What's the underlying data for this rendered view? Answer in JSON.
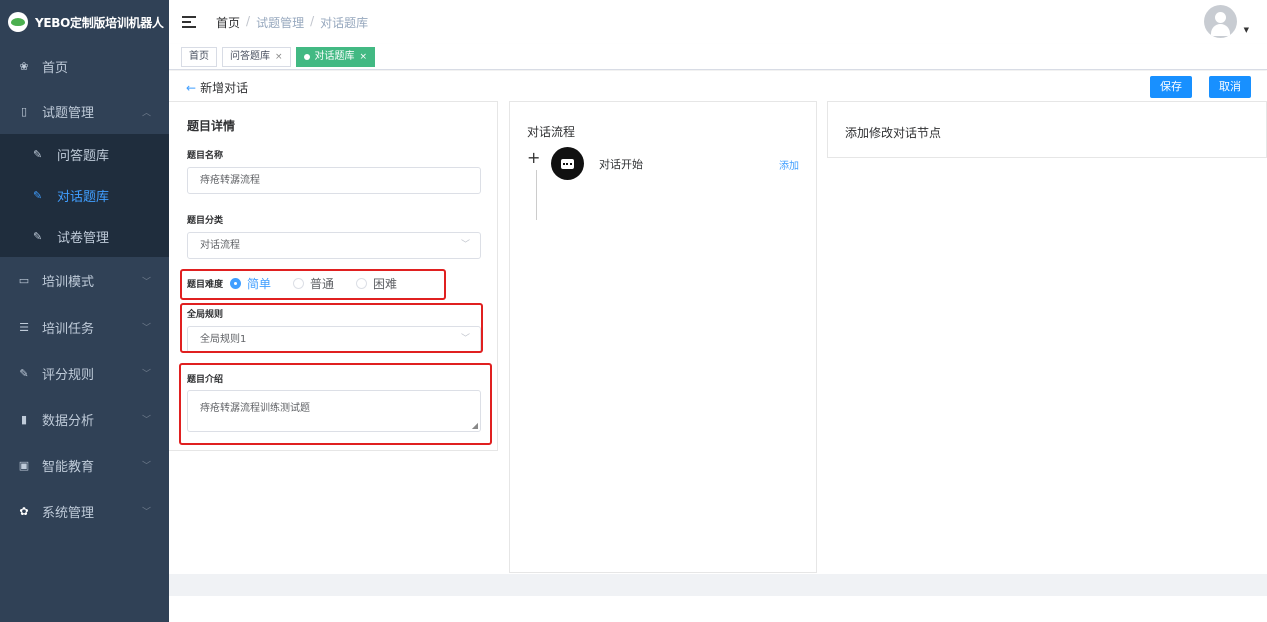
{
  "sidebar": {
    "logo_text": "YEBO定制版培训机器人",
    "items": [
      {
        "label": "首页",
        "icon": "dashboard-icon"
      },
      {
        "label": "试题管理",
        "icon": "book-icon"
      },
      {
        "label": "培训模式",
        "icon": "monitor-icon"
      },
      {
        "label": "培训任务",
        "icon": "list-icon"
      },
      {
        "label": "评分规则",
        "icon": "edit-icon"
      },
      {
        "label": "数据分析",
        "icon": "chart-icon"
      },
      {
        "label": "智能教育",
        "icon": "screen-icon"
      },
      {
        "label": "系统管理",
        "icon": "gear-icon"
      }
    ],
    "sub_items": [
      {
        "label": "问答题库"
      },
      {
        "label": "对话题库"
      },
      {
        "label": "试卷管理"
      }
    ]
  },
  "header": {
    "breadcrumb": [
      "首页",
      "试题管理",
      "对话题库"
    ],
    "separator": "/"
  },
  "tags": [
    {
      "label": "首页"
    },
    {
      "label": "问答题库"
    },
    {
      "label": "对话题库"
    }
  ],
  "page": {
    "back_label": "新增对话",
    "save_label": "保存",
    "cancel_label": "取消"
  },
  "details": {
    "title": "题目详情",
    "name_label": "题目名称",
    "name_value": "痔疮转潺流程",
    "category_label": "题目分类",
    "category_value": "对话流程",
    "difficulty_label": "题目难度",
    "difficulty_options": [
      "简单",
      "普通",
      "困难"
    ],
    "difficulty_selected": "简单",
    "rule_label": "全局规则",
    "rule_value": "全局规则1",
    "intro_label": "题目介绍",
    "intro_value": "痔疮转潺流程训练测试题"
  },
  "flow": {
    "title": "对话流程",
    "node_label": "对话开始",
    "add_label": "添加"
  },
  "node_editor": {
    "title": "添加修改对话节点"
  },
  "colors": {
    "sidebar_bg": "#304156",
    "submenu_bg": "#1f2d3d",
    "accent": "#409eff",
    "tag_active": "#42b983",
    "highlight": "#e02020",
    "button": "#1890ff"
  }
}
